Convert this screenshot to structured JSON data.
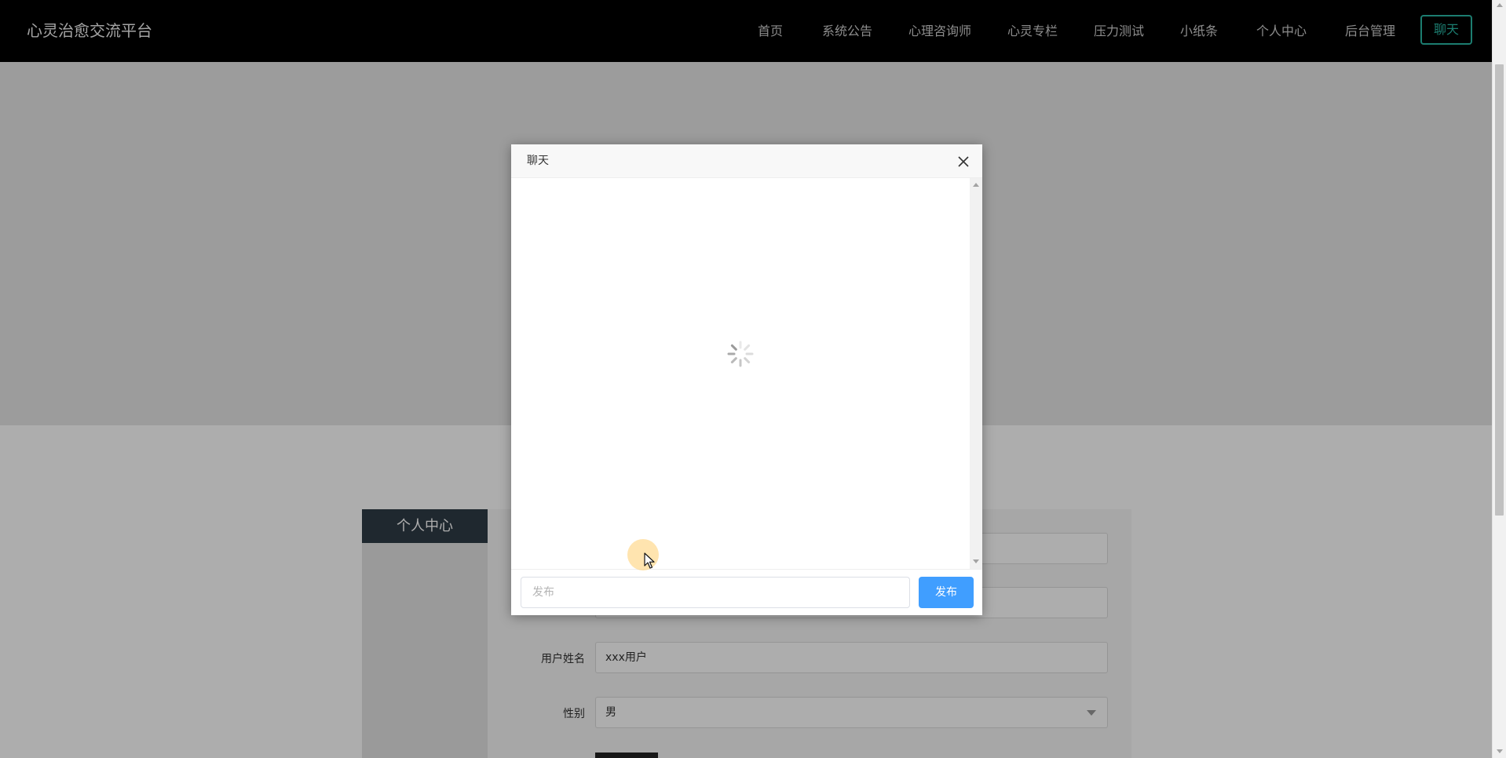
{
  "brand": "心灵治愈交流平台",
  "nav": {
    "items": [
      "首页",
      "系统公告",
      "心理咨询师",
      "心灵专栏",
      "压力测试",
      "小纸条",
      "个人中心",
      "后台管理"
    ],
    "chat_label": "聊天"
  },
  "sidebar": {
    "title": "个人中心"
  },
  "form": {
    "name_label": "用户姓名",
    "name_value": "xxx用户",
    "gender_label": "性别",
    "gender_value": "男"
  },
  "modal": {
    "title": "聊天",
    "input_placeholder": "发布",
    "send_label": "发布",
    "loading": true
  },
  "colors": {
    "topbar": "#000000",
    "accent": "#2ab8a6",
    "primary_button": "#409eff",
    "sidebar_header": "#2f3b46"
  },
  "icons": {
    "close": "close-icon",
    "spinner": "loading-spinner-icon",
    "select_caret": "chevron-down-icon"
  }
}
